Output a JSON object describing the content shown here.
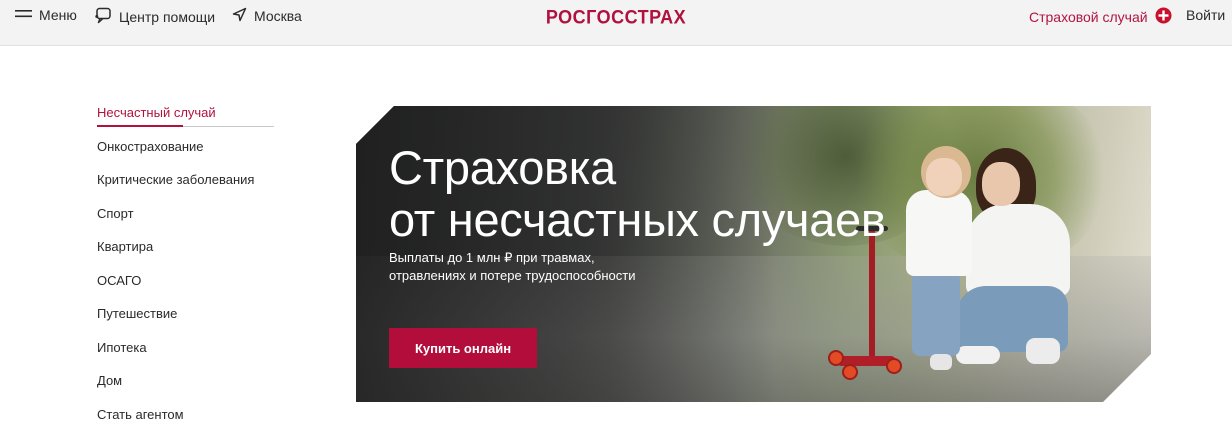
{
  "header": {
    "menu_label": "Меню",
    "help_label": "Центр помощи",
    "city_label": "Москва",
    "logo_text": "РОСГОССТРАХ",
    "claim_label": "Страховой случай",
    "login_label": "Войти"
  },
  "sidebar": {
    "items": [
      {
        "label": "Несчастный случай",
        "active": true
      },
      {
        "label": "Онкострахование"
      },
      {
        "label": "Критические заболевания"
      },
      {
        "label": "Спорт"
      },
      {
        "label": "Квартира"
      },
      {
        "label": "ОСАГО"
      },
      {
        "label": "Путешествие"
      },
      {
        "label": "Ипотека"
      },
      {
        "label": "Дом"
      },
      {
        "label": "Стать агентом"
      }
    ]
  },
  "banner": {
    "title_line1": "Страховка",
    "title_line2": "от несчастных случаев",
    "subtitle_line1": "Выплаты до 1 млн ₽ при травмах,",
    "subtitle_line2": "отравлениях и потере трудоспособности",
    "cta_label": "Купить онлайн"
  },
  "colors": {
    "brand": "#b0123d",
    "cta": "#b30d3c",
    "header_bg": "#f3f3f4"
  },
  "icons": [
    "hamburger-icon",
    "chat-help-icon",
    "location-arrow-icon",
    "plus-circle-icon"
  ]
}
